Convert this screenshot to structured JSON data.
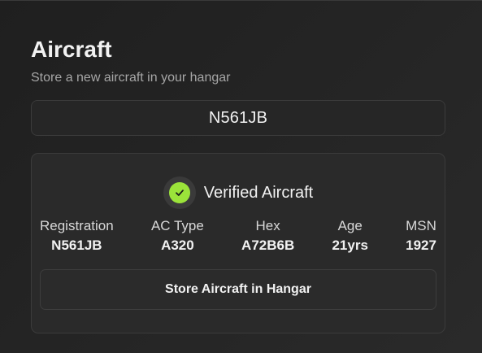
{
  "header": {
    "title": "Aircraft",
    "subtitle": "Store a new aircraft in your hangar"
  },
  "registration_input": {
    "value": "N561JB"
  },
  "verification": {
    "icon": "check-circle-icon",
    "label": "Verified Aircraft",
    "accent_color": "#9be33a"
  },
  "aircraft_details": [
    {
      "label": "Registration",
      "value": "N561JB"
    },
    {
      "label": "AC Type",
      "value": "A320"
    },
    {
      "label": "Hex",
      "value": "A72B6B"
    },
    {
      "label": "Age",
      "value": "21yrs"
    },
    {
      "label": "MSN",
      "value": "1927"
    }
  ],
  "actions": {
    "store_label": "Store Aircraft in Hangar"
  }
}
